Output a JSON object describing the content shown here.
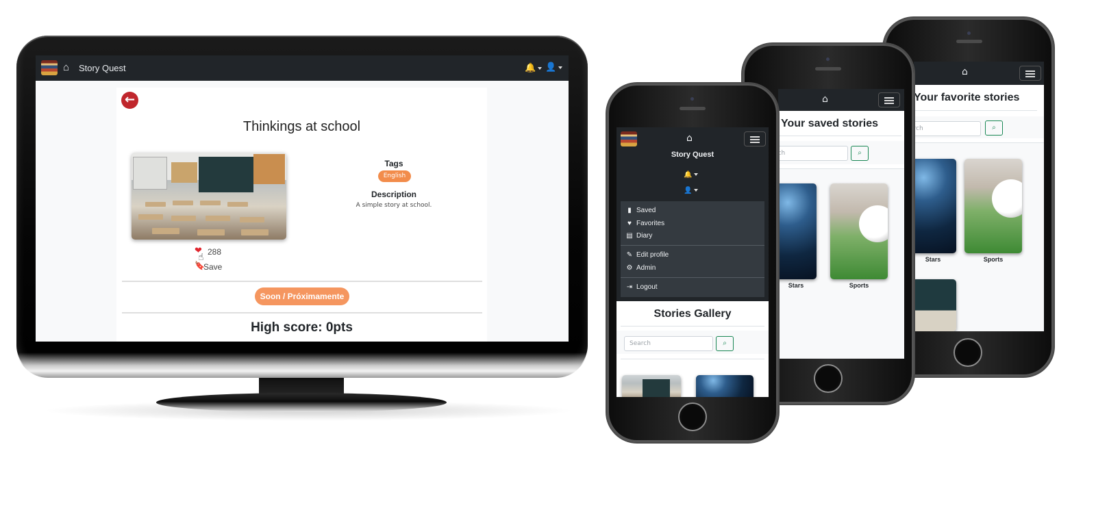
{
  "desktop": {
    "app_name": "Story Quest",
    "story_title": "Thinkings at school",
    "tags_heading": "Tags",
    "tag": "English",
    "description_heading": "Description",
    "description": "A simple story at school.",
    "likes": "288",
    "save_label": "Save",
    "soon_button": "Soon / Próximamente",
    "high_score": "High score: 0pts"
  },
  "phone_menu": {
    "app_name": "Story Quest",
    "items": {
      "saved": "Saved",
      "favorites": "Favorites",
      "diary": "Diary",
      "edit_profile": "Edit profile",
      "admin": "Admin",
      "logout": "Logout"
    },
    "gallery_title": "Stories Gallery",
    "search_placeholder": "Search"
  },
  "phone_saved": {
    "title": "Your saved stories",
    "search_placeholder": "rch",
    "cards": [
      "Stars",
      "Sports"
    ]
  },
  "phone_favorites": {
    "title": "Your favorite stories",
    "search_placeholder": "arch",
    "cards": [
      "Stars",
      "Sports"
    ]
  },
  "colors": {
    "navbar": "#212529",
    "accent_orange": "#f28c4b",
    "back_red": "#c0262c",
    "search_green": "#198754"
  }
}
